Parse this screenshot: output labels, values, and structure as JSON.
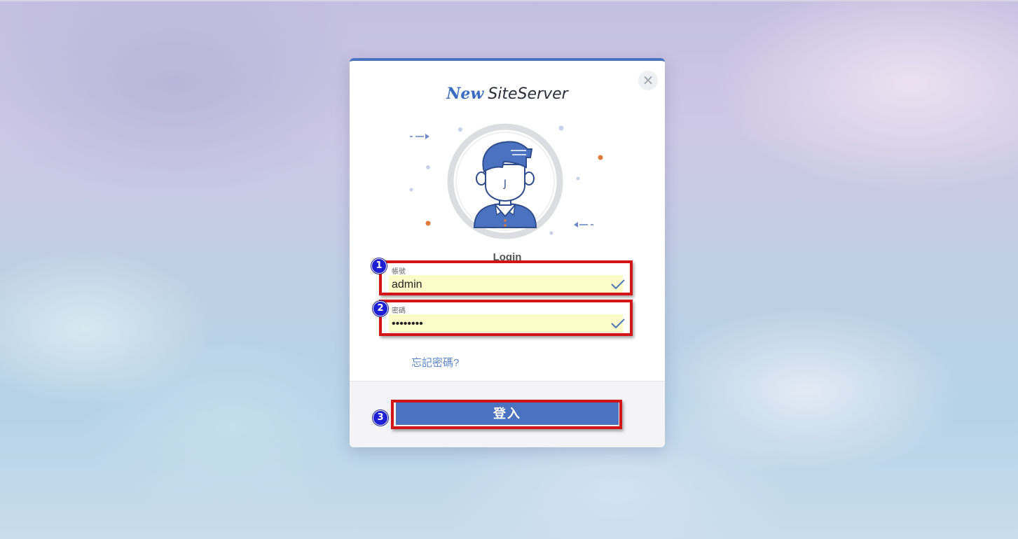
{
  "card": {
    "close_symbol": "×",
    "brand_new": "New",
    "brand_name": "SiteServer",
    "avatar_initial": "J",
    "login_title": "Login"
  },
  "form": {
    "username": {
      "label": "帳號",
      "value": "admin"
    },
    "password": {
      "label": "密碼",
      "value": "••••••••"
    },
    "forgot_link": "忘記密碼?",
    "submit_label": "登入"
  },
  "annotations": {
    "markers": [
      "1",
      "2",
      "3"
    ],
    "highlight_color": "#d21416",
    "marker_color": "#1e1ed4"
  },
  "colors": {
    "accent": "#4a72c0",
    "input_autofill_bg": "#fbfcc8",
    "check": "#4a74c0",
    "dot_orange": "#e07a3a"
  },
  "icons": {
    "close": "close-icon",
    "field_valid": "check-icon",
    "avatar": "user-avatar-icon"
  }
}
